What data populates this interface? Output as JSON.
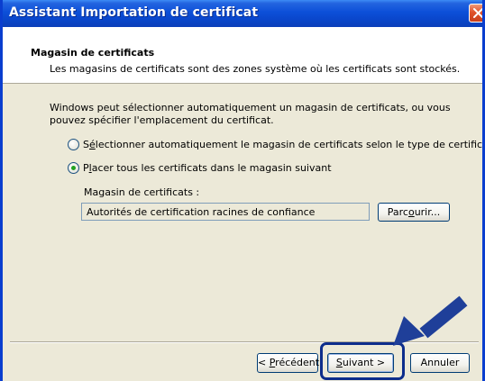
{
  "window": {
    "title": "Assistant Importation de certificat"
  },
  "header": {
    "title": "Magasin de certificats",
    "subtitle": "Les magasins de certificats sont des zones système où les certificats sont stockés."
  },
  "body": {
    "description": "Windows peut sélectionner automatiquement un magasin de certificats, ou vous pouvez spécifier l'emplacement du certificat.",
    "options": [
      {
        "label_pre": "S",
        "label_u": "é",
        "label_post": "lectionner automatiquement le magasin de certificats selon le type de certificat",
        "checked": false
      },
      {
        "label_pre": "P",
        "label_u": "l",
        "label_post": "acer tous les certificats dans le magasin suivant",
        "checked": true
      }
    ],
    "store_label": "Magasin de certificats :",
    "store_value": "Autorités de certification racines de confiance",
    "browse_pre": "Parc",
    "browse_u": "o",
    "browse_post": "urir..."
  },
  "footer": {
    "back_pre": "< ",
    "back_u": "P",
    "back_post": "récédent",
    "next_u": "S",
    "next_post": "uivant >",
    "cancel_label": "Annuler"
  },
  "colors": {
    "titlebar": "#0a47cc",
    "dialog_bg": "#ece9d8",
    "accent_arrow": "#1f3f99",
    "radio_dot": "#21a121"
  },
  "icons": {
    "close": "close-icon",
    "annotation": "pointer-arrow-icon"
  }
}
